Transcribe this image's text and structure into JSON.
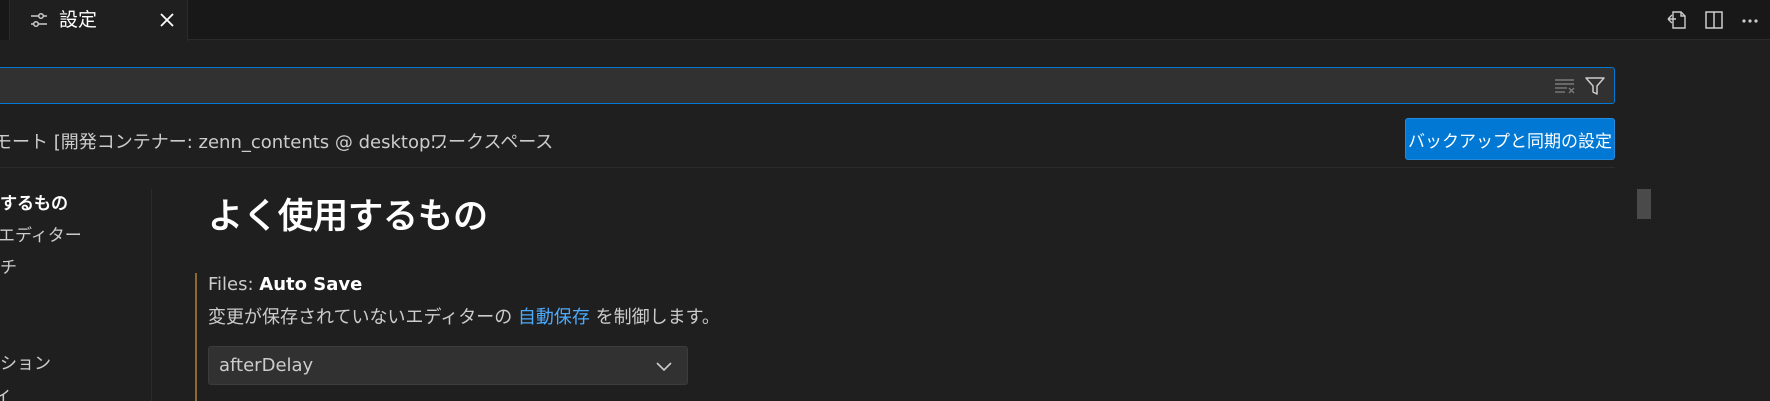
{
  "tab": {
    "title": "設定",
    "icon": "settings-sliders-icon"
  },
  "editor_actions": [
    {
      "name": "open-settings-json-icon"
    },
    {
      "name": "split-editor-icon"
    },
    {
      "name": "more-actions-icon"
    }
  ],
  "search": {
    "value": "",
    "placeholder": "",
    "clear_icon": "clear-filter-icon",
    "filter_icon": "filter-icon"
  },
  "scopes": {
    "remote_label": "モート [開発コンテナー: zenn_contents @ desktop...",
    "workspace_label": "ワークスペース",
    "sync_button": "バックアップと同期の設定"
  },
  "toc": {
    "items": [
      {
        "label": "するもの",
        "active": true
      },
      {
        "label": "エディター",
        "active": false
      },
      {
        "label": "チ",
        "active": false
      },
      {
        "label": "ション",
        "active": false
      },
      {
        "label": "イ",
        "active": false
      }
    ]
  },
  "main": {
    "section_title": "よく使用するもの",
    "setting": {
      "category": "Files: ",
      "label": "Auto Save",
      "description_before": "変更が保存されていないエディターの ",
      "description_link": "自動保存",
      "description_after": " を制御します。",
      "value": "afterDelay"
    }
  },
  "colors": {
    "background": "#1f1f1f",
    "accent": "#0078d4",
    "link": "#4daafc",
    "modified_indicator": "#8a6a2e"
  }
}
